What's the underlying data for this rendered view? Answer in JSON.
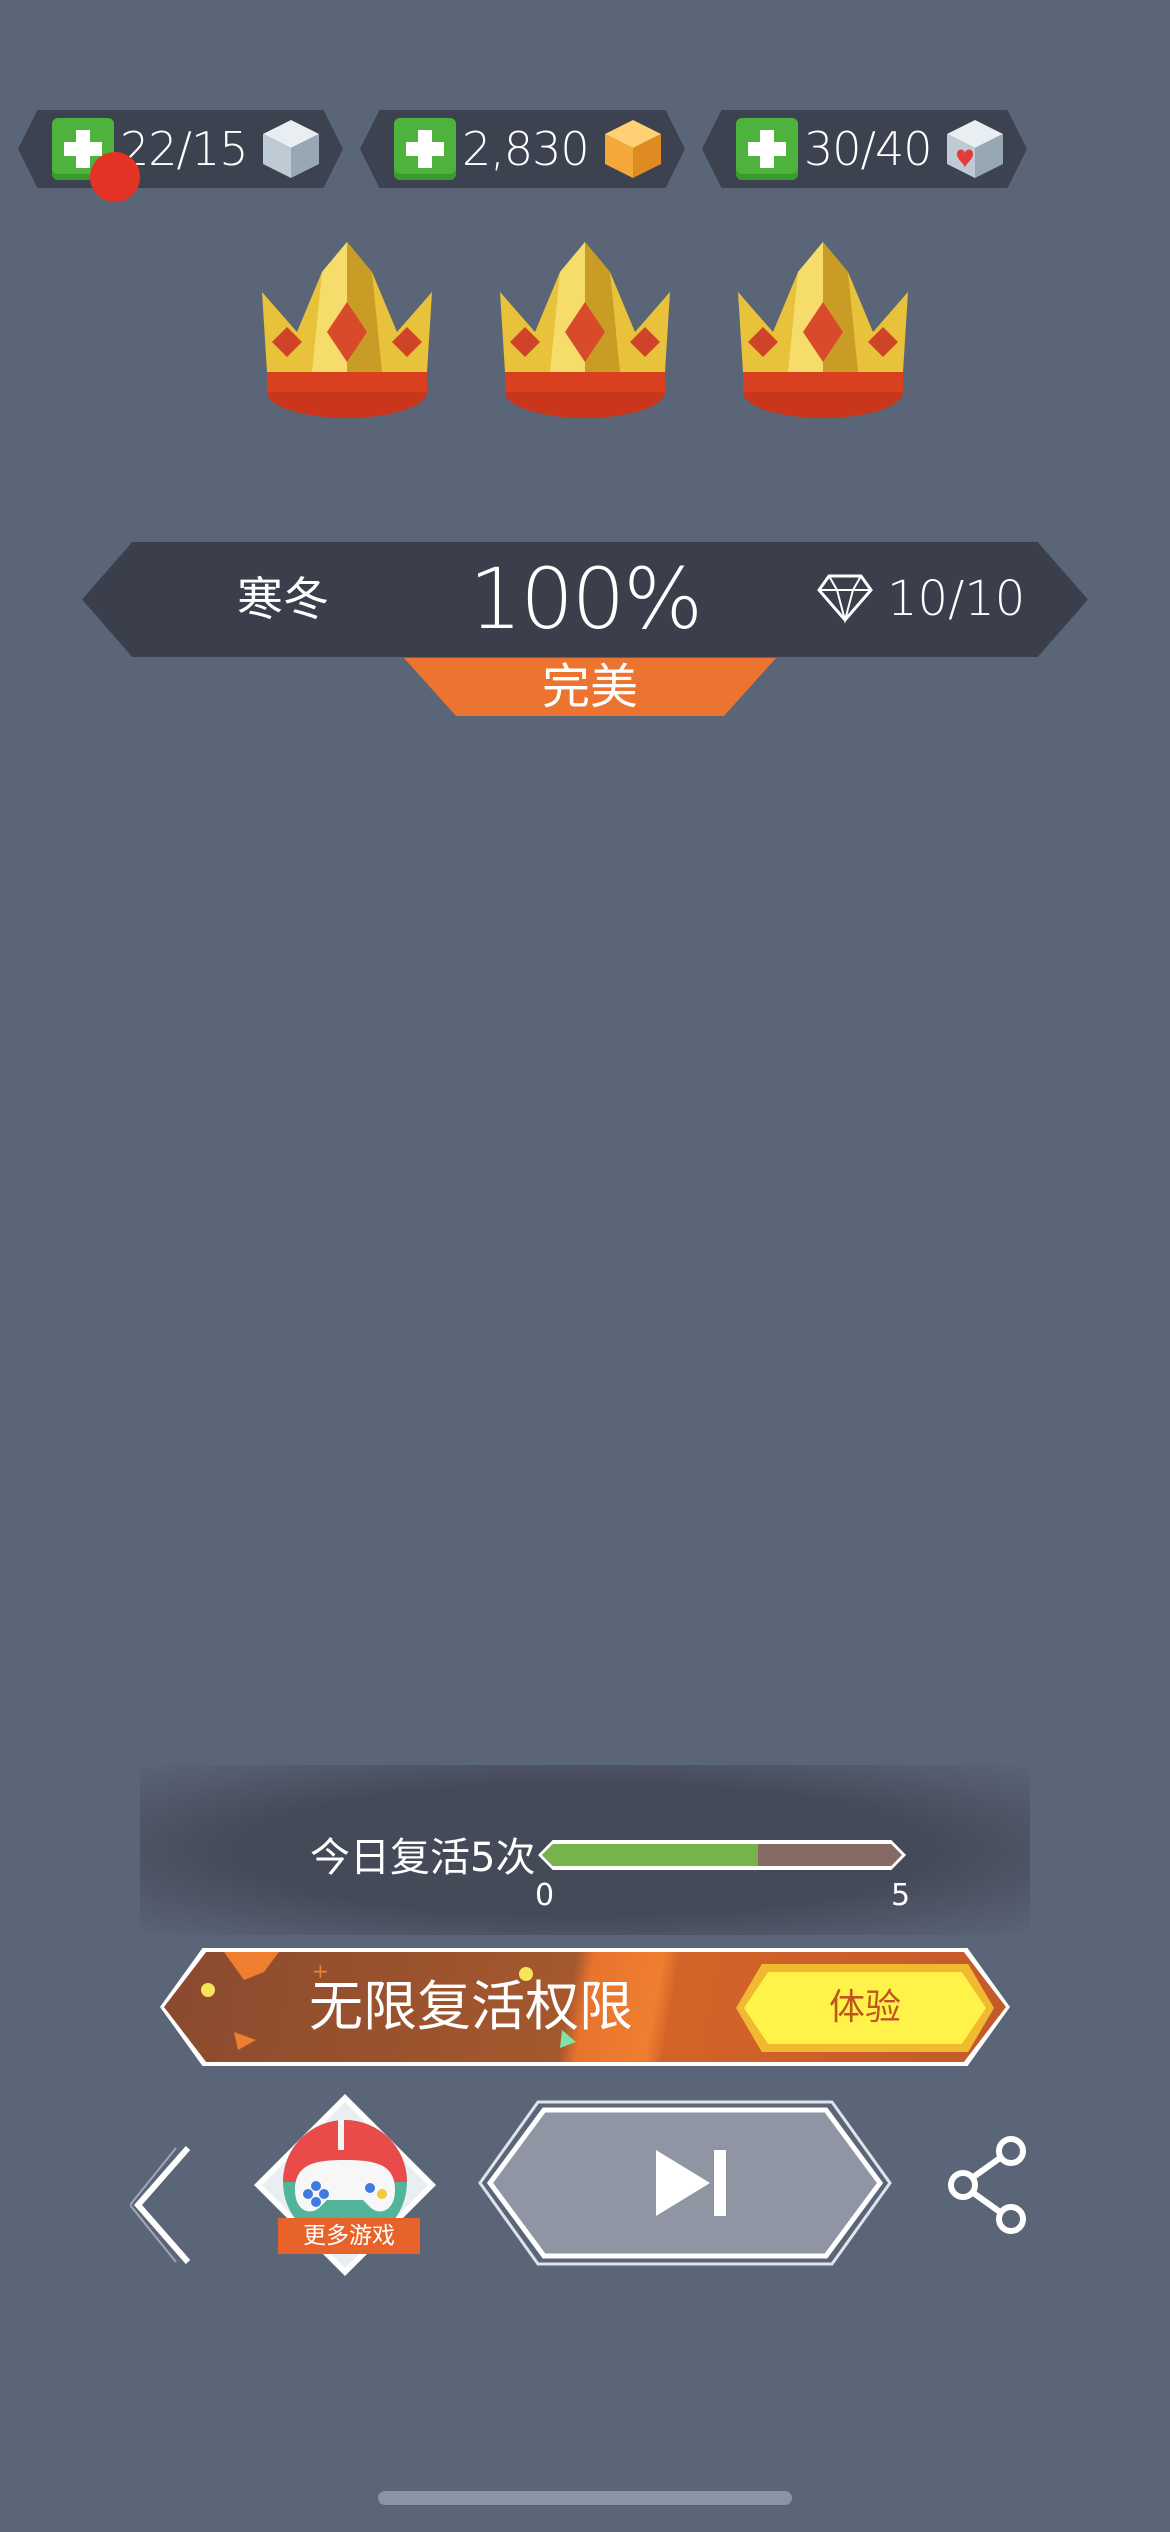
{
  "resources": [
    {
      "value": "22/15",
      "icon": "ice-cube-icon",
      "has_notification": true
    },
    {
      "value": "2,830",
      "icon": "gold-cube-icon"
    },
    {
      "value": "30/40",
      "icon": "heart-cube-icon"
    }
  ],
  "crowns": {
    "earned": 3,
    "total": 3
  },
  "level": {
    "name": "寒冬",
    "percent": "100%",
    "gems": "10/10",
    "rating": "完美"
  },
  "revive": {
    "label": "今日复活5次",
    "progress_min": "0",
    "progress_max": "5",
    "progress_fraction": 0.6
  },
  "promo": {
    "text": "无限复活权限",
    "button": "体验"
  },
  "more_games": {
    "label": "更多游戏"
  },
  "colors": {
    "background": "#5b6578",
    "accent_orange": "#ec7430",
    "plus_green": "#4db33c",
    "progress_green": "#76b34a",
    "promo_button": "#fff34a"
  }
}
